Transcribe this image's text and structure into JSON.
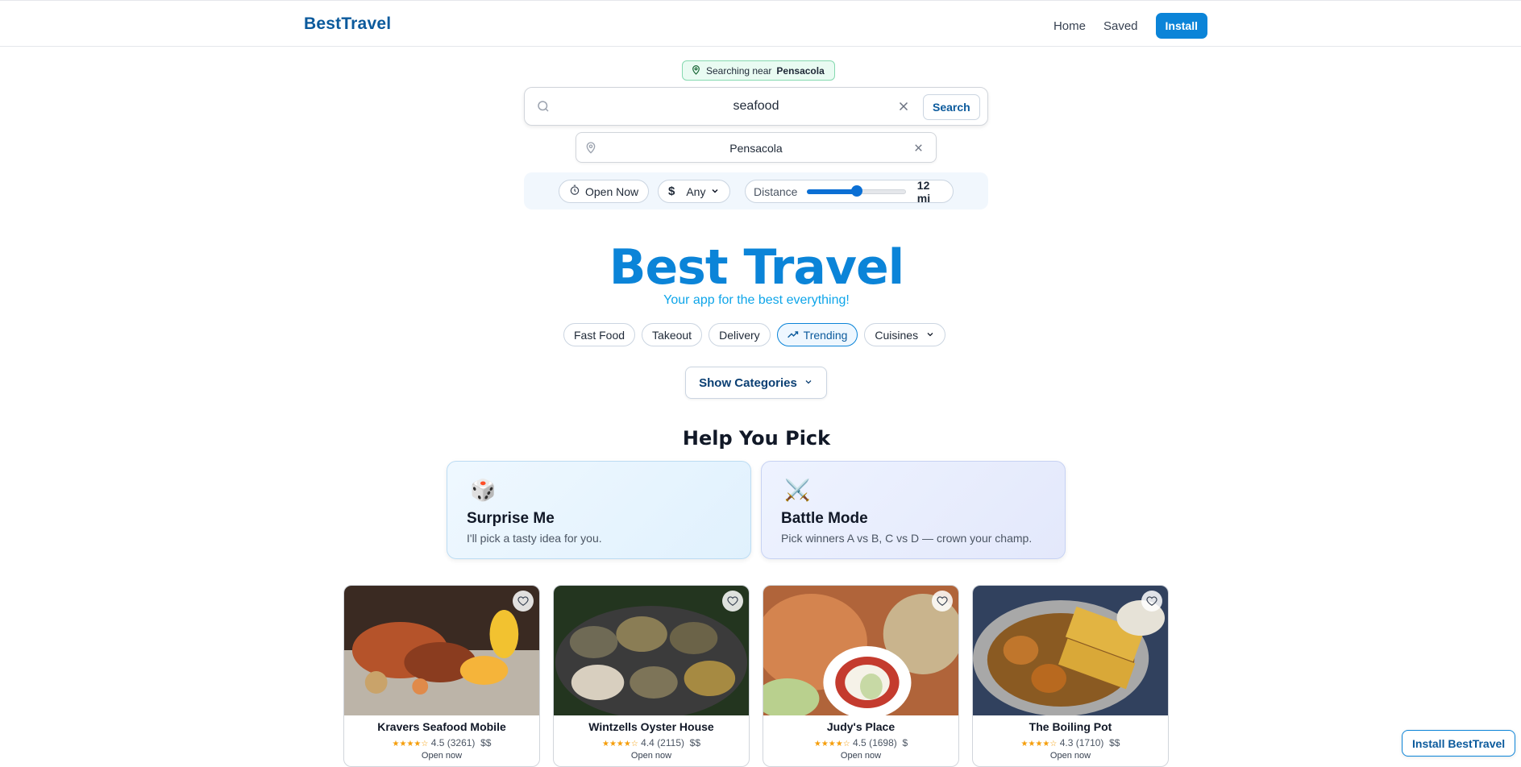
{
  "header": {
    "brand": "BestTravel",
    "nav": {
      "home": "Home",
      "saved": "Saved",
      "install": "Install"
    }
  },
  "location_chip": {
    "prefix": "Searching near",
    "city": "Pensacola"
  },
  "search": {
    "value": "seafood",
    "button_label": "Search",
    "location_value": "Pensacola"
  },
  "filters": {
    "open_now": "Open Now",
    "price": "Any",
    "distance_label": "Distance",
    "distance_value": "12 mi",
    "distance_fraction": 0.5
  },
  "hero": {
    "title": "Best Travel",
    "subtitle": "Your app for the best everything!"
  },
  "chips": [
    {
      "label": "Fast Food"
    },
    {
      "label": "Takeout"
    },
    {
      "label": "Delivery"
    },
    {
      "label": "Trending"
    },
    {
      "label": "Cuisines"
    }
  ],
  "show_categories": "Show Categories",
  "help": {
    "title": "Help You Pick",
    "cards": [
      {
        "emoji": "🎲",
        "title": "Surprise Me",
        "desc": "I'll pick a tasty idea for you."
      },
      {
        "emoji": "⚔️",
        "title": "Battle Mode",
        "desc": "Pick winners A vs B, C vs D — crown your champ."
      }
    ]
  },
  "restaurants": [
    {
      "name": "Kravers Seafood Mobile",
      "rating": "4.5",
      "reviews": "(3261)",
      "price": "$$",
      "stars": "★★★★☆",
      "status": "Open now"
    },
    {
      "name": "Wintzells Oyster House",
      "rating": "4.4",
      "reviews": "(2115)",
      "price": "$$",
      "stars": "★★★★☆",
      "status": "Open now"
    },
    {
      "name": "Judy's Place",
      "rating": "4.5",
      "reviews": "(1698)",
      "price": "$",
      "stars": "★★★★☆",
      "status": "Open now"
    },
    {
      "name": "The Boiling Pot",
      "rating": "4.3",
      "reviews": "(1710)",
      "price": "$$",
      "stars": "★★★★☆",
      "status": "Open now"
    }
  ],
  "floating_install": "Install BestTravel",
  "colors": {
    "brand": "#0b84d8",
    "brand_dark": "#0b5a9c",
    "star": "#f59e0b"
  }
}
